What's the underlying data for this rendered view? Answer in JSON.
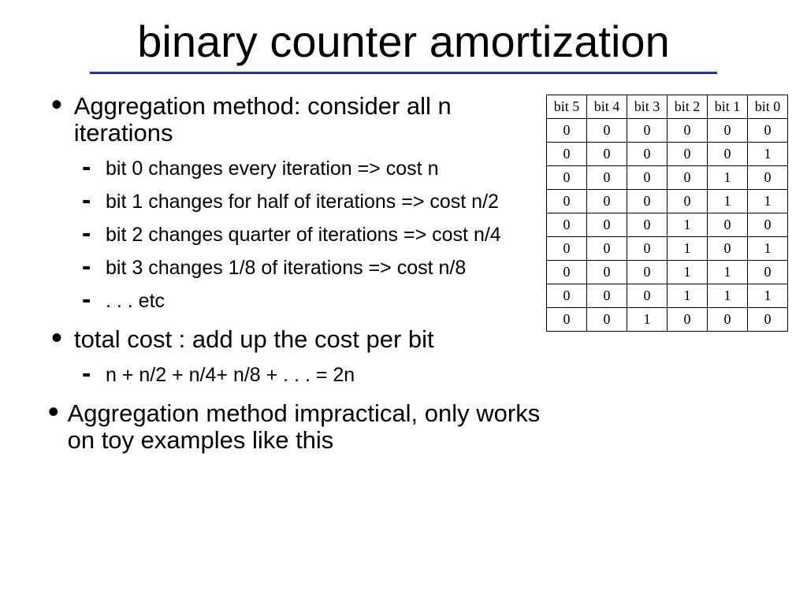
{
  "title": "binary counter amortization",
  "bullets": {
    "b1": "Aggregation method: consider all n iterations",
    "b1_sub": [
      "bit 0 changes every iteration => cost n",
      "bit 1 changes for half of iterations => cost n/2",
      "bit 2 changes quarter of iterations => cost n/4",
      "bit 3 changes 1/8 of iterations => cost n/8",
      ". . . etc"
    ],
    "b2": "total cost : add up the cost per bit",
    "b2_sub": [
      "n + n/2 + n/4+ n/8 + . . . = 2n"
    ],
    "b3": "Aggregation method impractical, only works on toy examples like this"
  },
  "table": {
    "headers": [
      "bit 5",
      "bit 4",
      "bit 3",
      "bit 2",
      "bit 1",
      "bit 0"
    ],
    "rows": [
      [
        "0",
        "0",
        "0",
        "0",
        "0",
        "0"
      ],
      [
        "0",
        "0",
        "0",
        "0",
        "0",
        "1"
      ],
      [
        "0",
        "0",
        "0",
        "0",
        "1",
        "0"
      ],
      [
        "0",
        "0",
        "0",
        "0",
        "1",
        "1"
      ],
      [
        "0",
        "0",
        "0",
        "1",
        "0",
        "0"
      ],
      [
        "0",
        "0",
        "0",
        "1",
        "0",
        "1"
      ],
      [
        "0",
        "0",
        "0",
        "1",
        "1",
        "0"
      ],
      [
        "0",
        "0",
        "0",
        "1",
        "1",
        "1"
      ],
      [
        "0",
        "0",
        "1",
        "0",
        "0",
        "0"
      ]
    ]
  }
}
